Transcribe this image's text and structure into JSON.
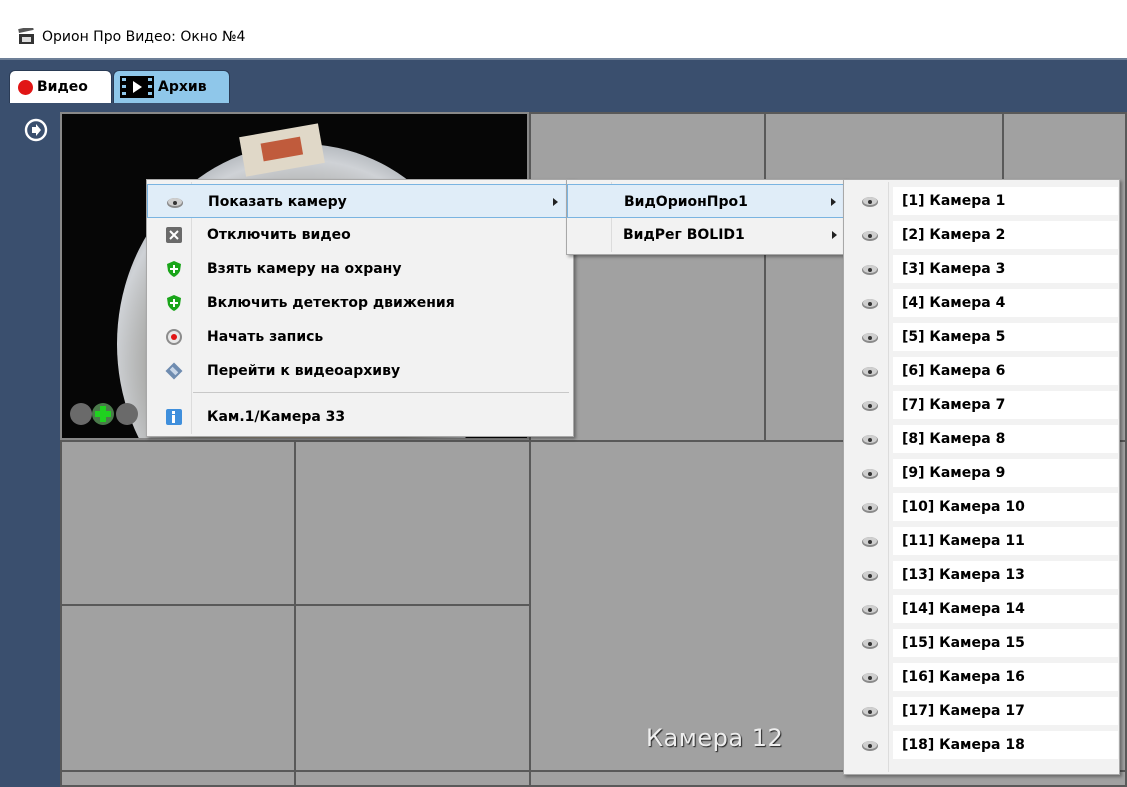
{
  "window": {
    "title": "Орион Про Видео: Окно №4",
    "icon": "app-video-icon"
  },
  "tabs": [
    {
      "label": "Видео",
      "icon": "record-dot-icon",
      "active": true
    },
    {
      "label": "Архив",
      "icon": "film-play-icon",
      "active": false
    }
  ],
  "grid": {
    "cell_label_camera12": "Камера 12"
  },
  "context_menu": {
    "items": [
      {
        "label": "Показать камеру",
        "icon": "camera-icon",
        "submenu": true,
        "highlighted": true
      },
      {
        "label": "Отключить видео",
        "icon": "close-box-icon"
      },
      {
        "label": "Взять камеру на охрану",
        "icon": "shield-plus-icon"
      },
      {
        "label": "Включить детектор движения",
        "icon": "shield-plus-icon"
      },
      {
        "label": "Начать запись",
        "icon": "record-icon"
      },
      {
        "label": "Перейти к видеоархиву",
        "icon": "archive-icon"
      },
      {
        "label": "Кам.1/Камера 33",
        "icon": "info-icon"
      }
    ]
  },
  "servers_menu": {
    "items": [
      {
        "label": "ВидОрионПро1",
        "submenu": true,
        "highlighted": true
      },
      {
        "label": "ВидРег BOLID1",
        "submenu": true
      }
    ]
  },
  "cameras_menu": {
    "items": [
      "[1] Камера 1",
      "[2] Камера 2",
      "[3] Камера 3",
      "[4] Камера 4",
      "[5] Камера 5",
      "[6] Камера 6",
      "[7] Камера 7",
      "[8] Камера 8",
      "[9] Камера 9",
      "[10] Камера 10",
      "[11] Камера 11",
      "[13] Камера 13",
      "[14] Камера 14",
      "[15] Камера 15",
      "[16] Камера 16",
      "[17] Камера 17",
      "[18] Камера 18"
    ]
  },
  "colors": {
    "frame": "#3a4f6e",
    "cell": "#a1a1a1",
    "archive_tab": "#8fc7ea",
    "record": "#e11515"
  }
}
